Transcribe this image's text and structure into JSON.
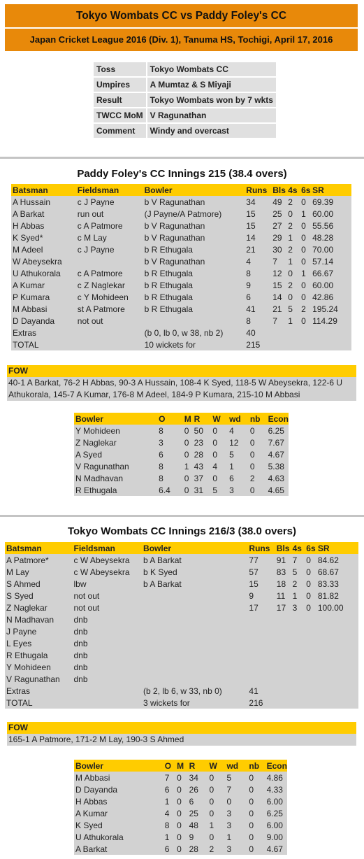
{
  "header": {
    "title": "Tokyo Wombats CC vs Paddy Foley's CC",
    "subtitle": "Japan Cricket League 2016 (Div. 1), Tanuma HS, Tochigi, April 17, 2016"
  },
  "match_info": [
    {
      "key": "Toss",
      "value": "Tokyo Wombats CC"
    },
    {
      "key": "Umpires",
      "value": "A Mumtaz & S Miyaji"
    },
    {
      "key": "Result",
      "value": "Tokyo Wombats won by 7 wkts"
    },
    {
      "key": "TWCC MoM",
      "value": "V Ragunathan"
    },
    {
      "key": "Comment",
      "value": "Windy and overcast"
    }
  ],
  "innings": [
    {
      "title": "Paddy Foley's CC Innings 215 (38.4 overs)",
      "batting_headers": [
        "Batsman",
        "Fieldsman",
        "Bowler",
        "Runs",
        "Bls",
        "4s",
        "6s",
        "SR"
      ],
      "batting": [
        [
          "A Hussain",
          "c J Payne",
          "b V Ragunathan",
          "34",
          "49",
          "2",
          "0",
          "69.39"
        ],
        [
          "A Barkat",
          "run out",
          "(J Payne/A Patmore)",
          "15",
          "25",
          "0",
          "1",
          "60.00"
        ],
        [
          "H Abbas",
          "c A Patmore",
          "b V Ragunathan",
          "15",
          "27",
          "2",
          "0",
          "55.56"
        ],
        [
          "K Syed*",
          "c M Lay",
          "b V Ragunathan",
          "14",
          "29",
          "1",
          "0",
          "48.28"
        ],
        [
          "M Adeel",
          "c J Payne",
          "b R Ethugala",
          "21",
          "30",
          "2",
          "0",
          "70.00"
        ],
        [
          "W Abeysekra",
          "",
          "b V Ragunathan",
          "4",
          "7",
          "1",
          "0",
          "57.14"
        ],
        [
          "U Athukorala",
          "c A Patmore",
          "b R Ethugala",
          "8",
          "12",
          "0",
          "1",
          "66.67"
        ],
        [
          "A Kumar",
          "c Z Naglekar",
          "b R Ethugala",
          "9",
          "15",
          "2",
          "0",
          "60.00"
        ],
        [
          "P Kumara",
          "c Y Mohideen",
          "b R Ethugala",
          "6",
          "14",
          "0",
          "0",
          "42.86"
        ],
        [
          "M Abbasi",
          "st A Patmore",
          "b R Ethugala",
          "41",
          "21",
          "5",
          "2",
          "195.24"
        ],
        [
          "D Dayanda",
          "not out",
          "",
          "8",
          "7",
          "1",
          "0",
          "114.29"
        ]
      ],
      "extras": {
        "label": "Extras",
        "detail": "(b 0, lb 0, w 38, nb 2)",
        "runs": "40"
      },
      "total": {
        "label": "TOTAL",
        "detail": "10 wickets for",
        "runs": "215"
      },
      "fow_label": "FOW",
      "fow": "40-1 A Barkat, 76-2 H Abbas, 90-3 A Hussain, 108-4 K Syed, 118-5 W Abeysekra, 122-6 U Athukorala, 145-7 A Kumar, 176-8 M Adeel, 184-9 P Kumara, 215-10 M Abbasi",
      "bowling_headers": [
        "Bowler",
        "O",
        "M",
        "R",
        "W",
        "wd",
        "nb",
        "Econ"
      ],
      "bowling": [
        [
          "Y Mohideen",
          "8",
          "0",
          "50",
          "0",
          "4",
          "0",
          "6.25"
        ],
        [
          "Z Naglekar",
          "3",
          "0",
          "23",
          "0",
          "12",
          "0",
          "7.67"
        ],
        [
          "A Syed",
          "6",
          "0",
          "28",
          "0",
          "5",
          "0",
          "4.67"
        ],
        [
          "V Ragunathan",
          "8",
          "1",
          "43",
          "4",
          "1",
          "0",
          "5.38"
        ],
        [
          "N Madhavan",
          "8",
          "0",
          "37",
          "0",
          "6",
          "2",
          "4.63"
        ],
        [
          "R Ethugala",
          "6.4",
          "0",
          "31",
          "5",
          "3",
          "0",
          "4.65"
        ]
      ]
    },
    {
      "title": "Tokyo Wombats CC Innings 216/3 (38.0 overs)",
      "batting_headers": [
        "Batsman",
        "Fieldsman",
        "Bowler",
        "Runs",
        "Bls",
        "4s",
        "6s",
        "SR"
      ],
      "batting": [
        [
          "A Patmore*",
          "c W Abeysekra",
          "b A Barkat",
          "77",
          "91",
          "7",
          "0",
          "84.62"
        ],
        [
          "M Lay",
          "c W Abeysekra",
          "b K Syed",
          "57",
          "83",
          "5",
          "0",
          "68.67"
        ],
        [
          "S Ahmed",
          "lbw",
          "b A Barkat",
          "15",
          "18",
          "2",
          "0",
          "83.33"
        ],
        [
          "S Syed",
          "not out",
          "",
          "9",
          "11",
          "1",
          "0",
          "81.82"
        ],
        [
          "Z Naglekar",
          "not out",
          "",
          "17",
          "17",
          "3",
          "0",
          "100.00"
        ],
        [
          "N Madhavan",
          "dnb",
          "",
          "",
          "",
          "",
          "",
          ""
        ],
        [
          "J Payne",
          "dnb",
          "",
          "",
          "",
          "",
          "",
          ""
        ],
        [
          "L Eyes",
          "dnb",
          "",
          "",
          "",
          "",
          "",
          ""
        ],
        [
          "R Ethugala",
          "dnb",
          "",
          "",
          "",
          "",
          "",
          ""
        ],
        [
          "Y Mohideen",
          "dnb",
          "",
          "",
          "",
          "",
          "",
          ""
        ],
        [
          "V Ragunathan",
          "dnb",
          "",
          "",
          "",
          "",
          "",
          ""
        ]
      ],
      "extras": {
        "label": "Extras",
        "detail": "(b 2, lb 6, w 33, nb 0)",
        "runs": "41"
      },
      "total": {
        "label": "TOTAL",
        "detail": "3 wickets for",
        "runs": "216"
      },
      "fow_label": "FOW",
      "fow": "165-1 A Patmore, 171-2 M Lay, 190-3 S Ahmed",
      "bowling_headers": [
        "Bowler",
        "O",
        "M",
        "R",
        "W",
        "wd",
        "nb",
        "Econ"
      ],
      "bowling": [
        [
          "M Abbasi",
          "7",
          "0",
          "34",
          "0",
          "5",
          "0",
          "4.86"
        ],
        [
          "D Dayanda",
          "6",
          "0",
          "26",
          "0",
          "7",
          "0",
          "4.33"
        ],
        [
          "H Abbas",
          "1",
          "0",
          "6",
          "0",
          "0",
          "0",
          "6.00"
        ],
        [
          "A Kumar",
          "4",
          "0",
          "25",
          "0",
          "3",
          "0",
          "6.25"
        ],
        [
          "K Syed",
          "8",
          "0",
          "48",
          "1",
          "3",
          "0",
          "6.00"
        ],
        [
          "U Athukorala",
          "1",
          "0",
          "9",
          "0",
          "1",
          "0",
          "9.00"
        ],
        [
          "A Barkat",
          "6",
          "0",
          "28",
          "2",
          "3",
          "0",
          "4.67"
        ]
      ]
    }
  ]
}
